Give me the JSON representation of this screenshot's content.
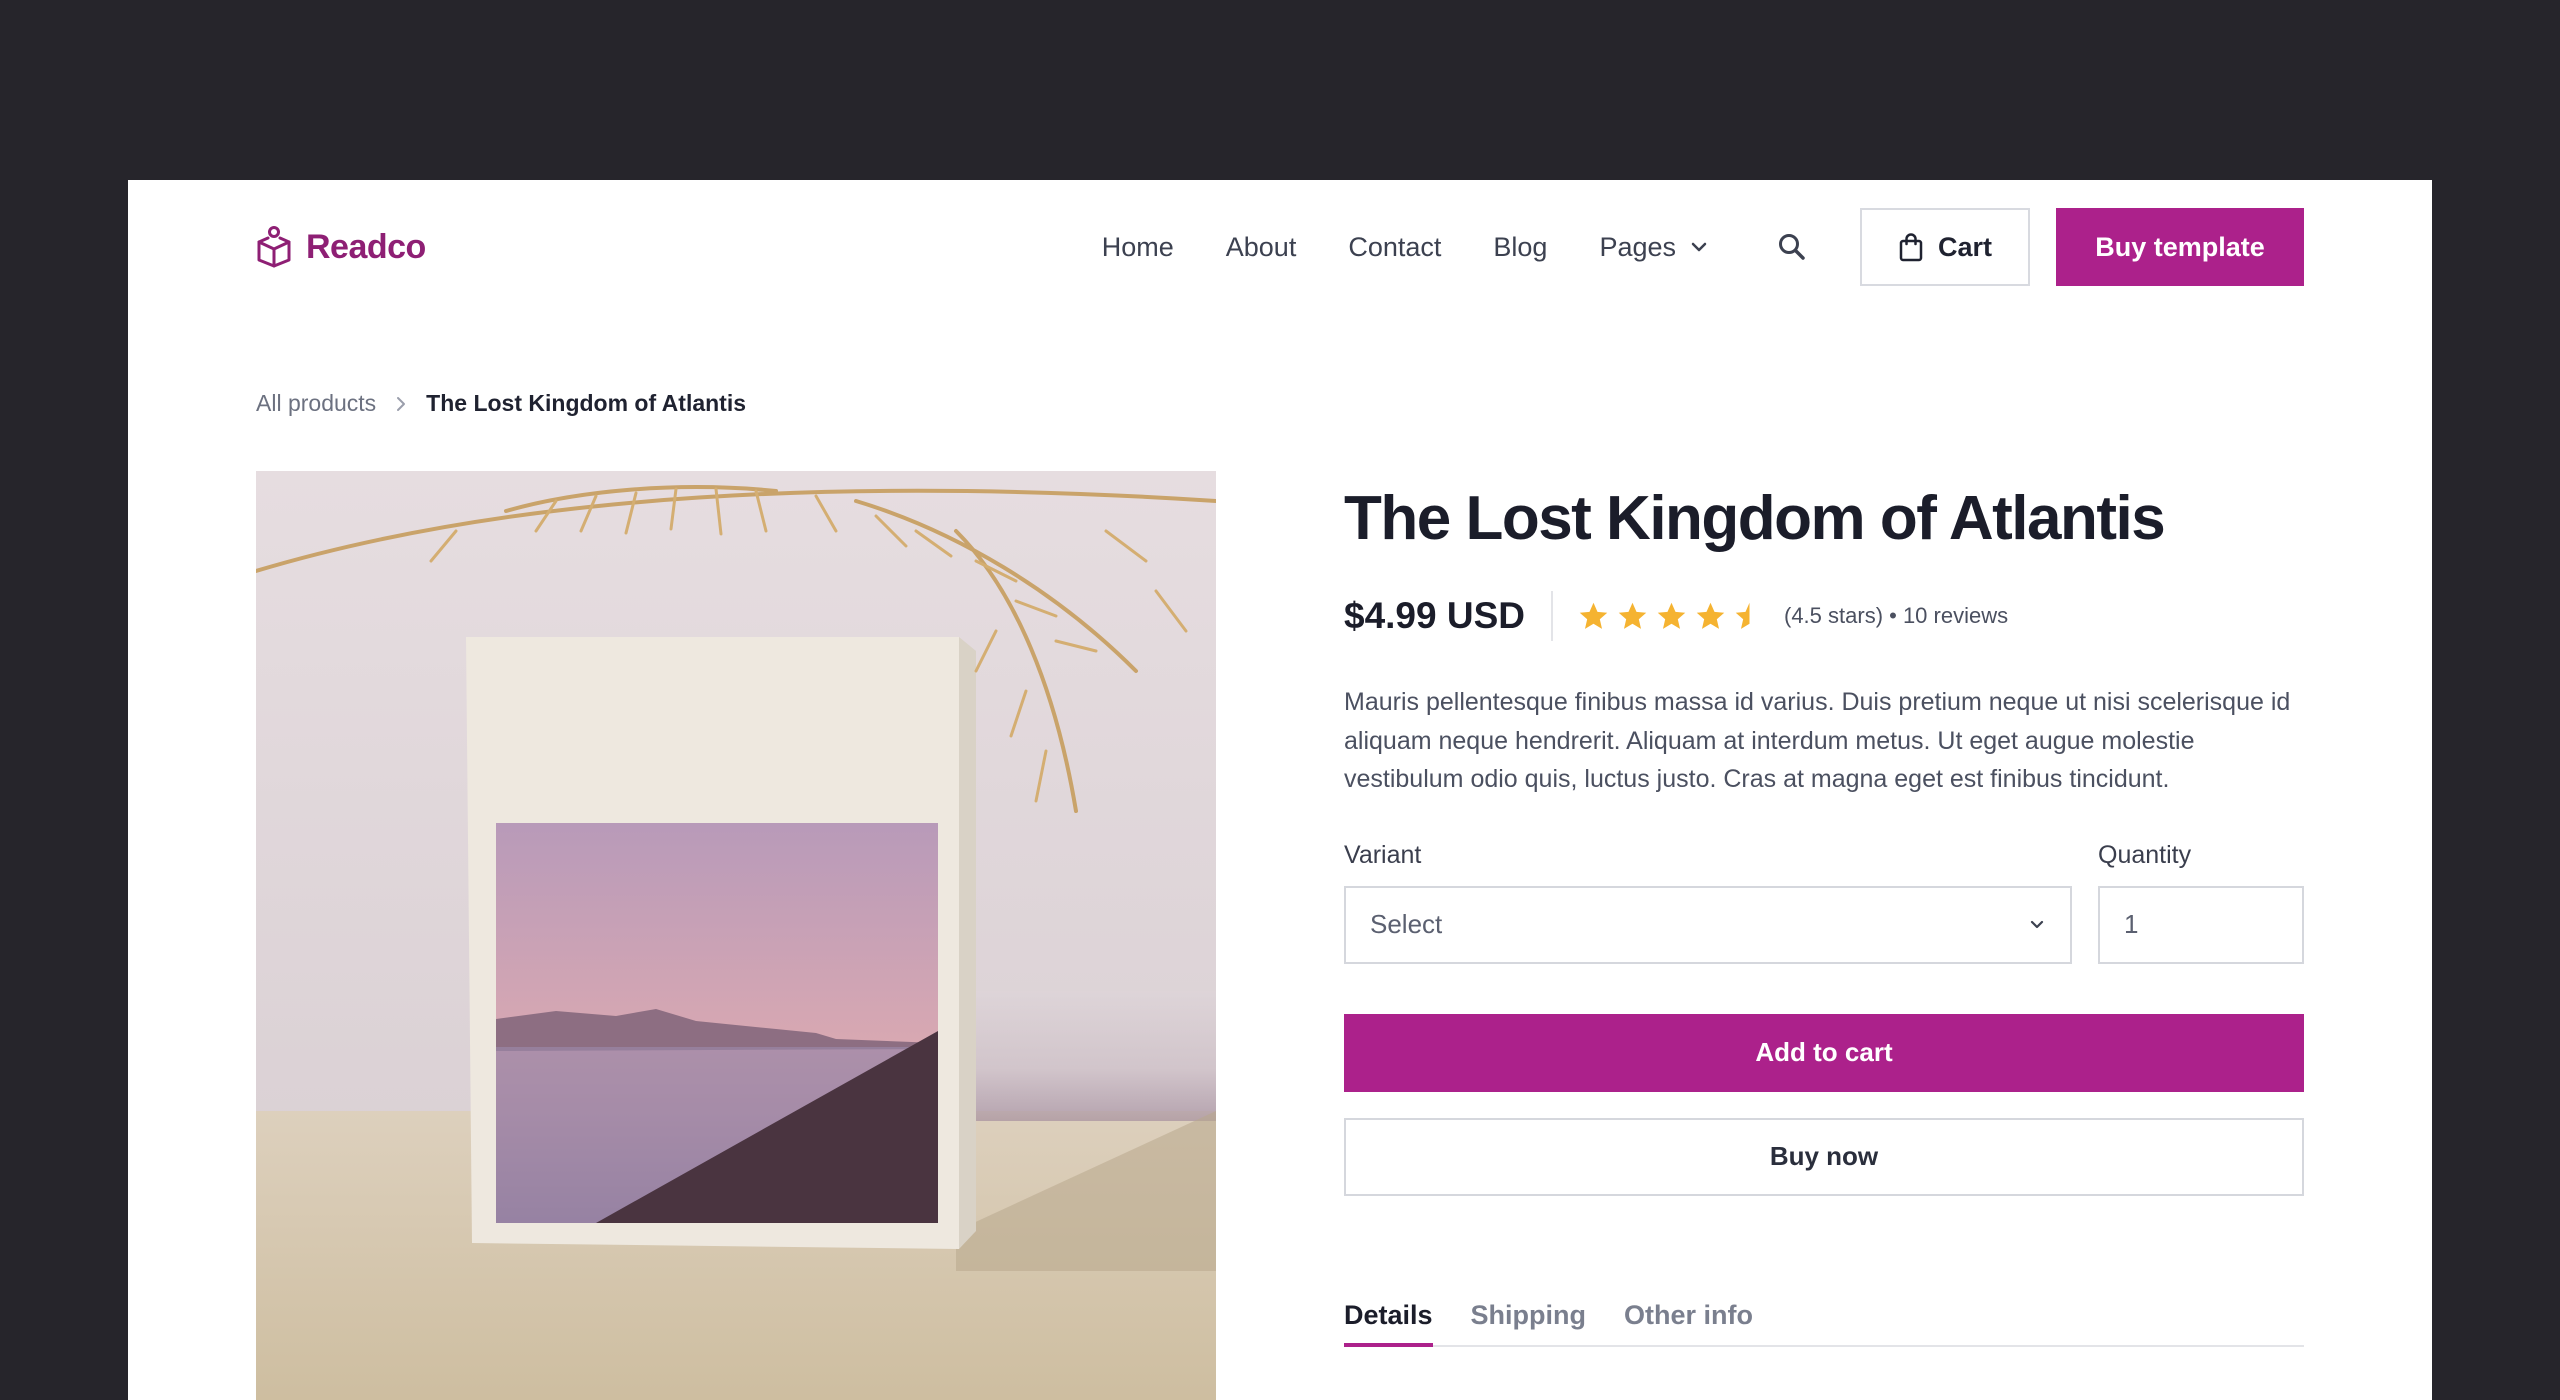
{
  "brand": {
    "name": "Readco",
    "logo_icon": "book-box-icon",
    "accent_color": "#ac218b",
    "logo_color": "#8e1f74"
  },
  "nav": {
    "links": [
      "Home",
      "About",
      "Contact",
      "Blog"
    ],
    "pages_label": "Pages",
    "search_icon": "search-icon",
    "cart_label": "Cart",
    "cart_icon": "shopping-bag-icon",
    "buy_template_label": "Buy template"
  },
  "breadcrumb": {
    "parent": "All products",
    "current": "The Lost Kingdom of Atlantis"
  },
  "product": {
    "title": "The Lost Kingdom of Atlantis",
    "price": "$4.99 USD",
    "rating": 4.5,
    "rating_text": "(4.5 stars) • 10 reviews",
    "star_color": "#f5b331",
    "description": "Mauris pellentesque finibus massa id varius. Duis pretium neque ut nisi scelerisque id aliquam neque hendrerit. Aliquam at interdum metus. Ut eget augue molestie vestibulum odio quis, luctus justo. Cras at magna eget est finibus tincidunt.",
    "variant_label": "Variant",
    "variant_value": "Select",
    "quantity_label": "Quantity",
    "quantity_value": "1",
    "add_to_cart_label": "Add to cart",
    "buy_now_label": "Buy now"
  },
  "tabs": [
    {
      "label": "Details",
      "active": true
    },
    {
      "label": "Shipping",
      "active": false
    },
    {
      "label": "Other info",
      "active": false
    }
  ]
}
